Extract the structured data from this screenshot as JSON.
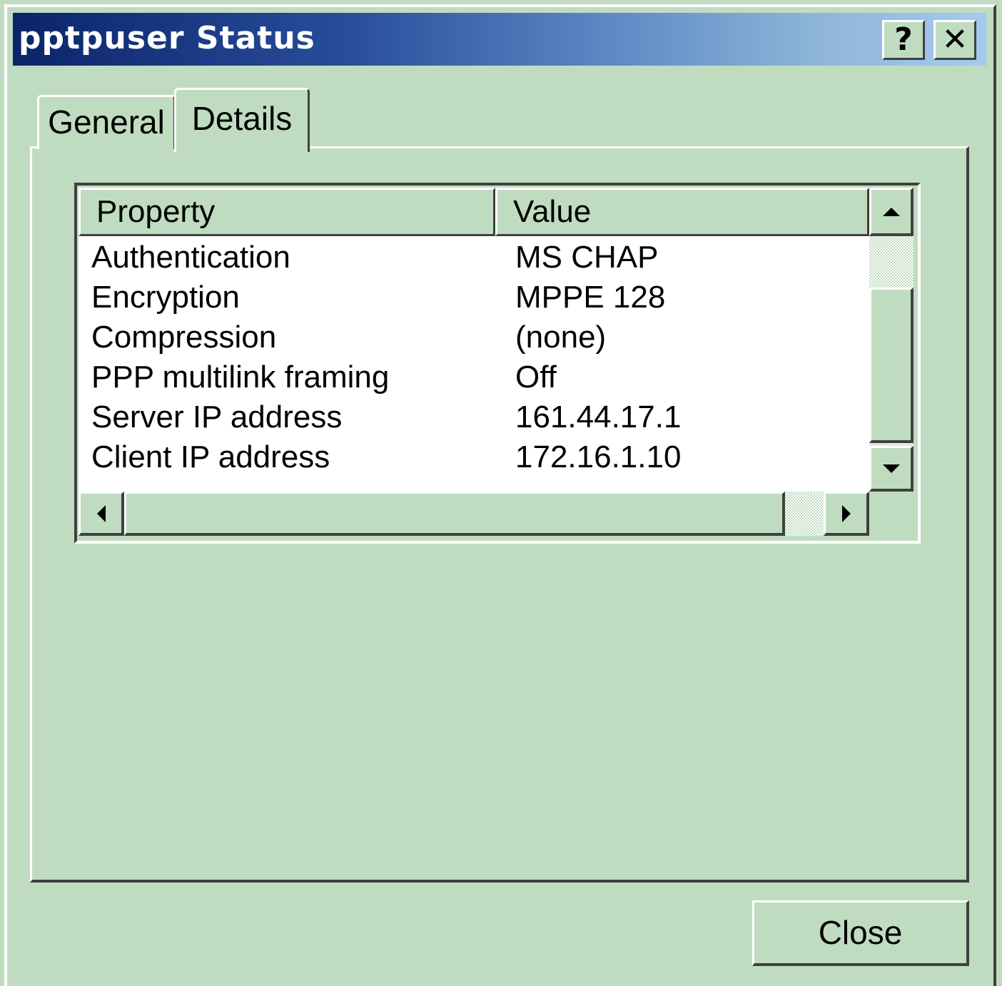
{
  "window": {
    "title": "pptpuser Status"
  },
  "caption_buttons": {
    "help": "?",
    "close": "✕"
  },
  "tabs": [
    {
      "label": "General",
      "active": false
    },
    {
      "label": "Details",
      "active": true
    }
  ],
  "list": {
    "columns": [
      "Property",
      "Value"
    ],
    "rows": [
      {
        "property": "Authentication",
        "value": "MS CHAP"
      },
      {
        "property": "Encryption",
        "value": "MPPE 128"
      },
      {
        "property": "Compression",
        "value": "(none)"
      },
      {
        "property": "PPP multilink framing",
        "value": "Off"
      },
      {
        "property": "Server IP address",
        "value": "161.44.17.1"
      },
      {
        "property": "Client IP address",
        "value": "172.16.1.10"
      }
    ]
  },
  "buttons": {
    "close_label": "Close"
  },
  "colors": {
    "window_bg": "#c0dcc0",
    "title_start": "#0a246a",
    "title_end": "#a6caf0"
  }
}
